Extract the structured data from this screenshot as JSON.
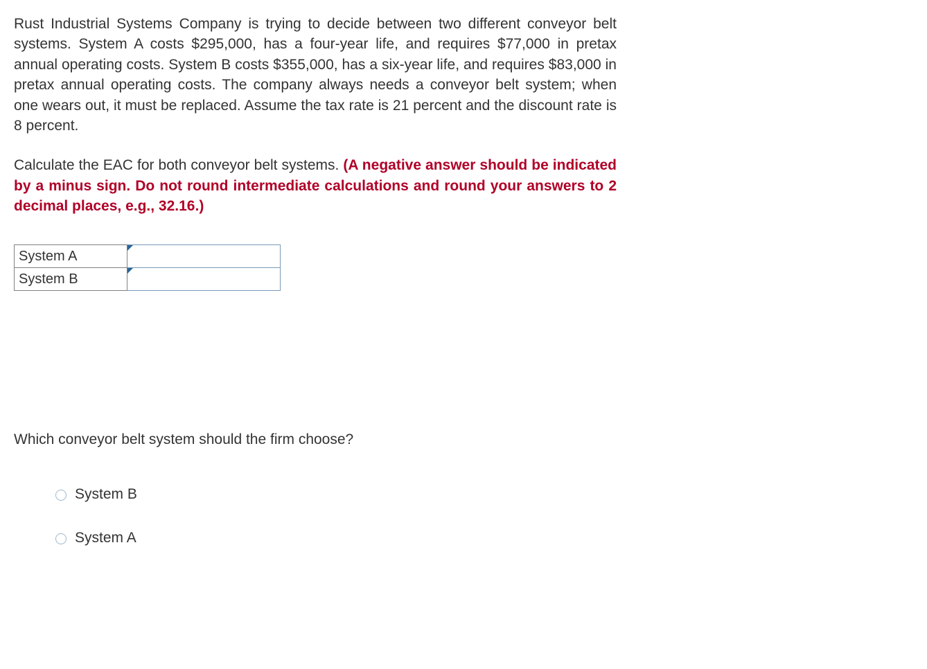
{
  "paragraph": "Rust Industrial Systems Company is trying to decide between two different conveyor belt systems. System A costs $295,000, has a four-year life, and requires $77,000 in pretax annual operating costs. System B costs $355,000, has a six-year life, and requires $83,000 in pretax annual operating costs. The company always needs a conveyor belt system; when one wears out, it must be replaced. Assume the tax rate is 21 percent and the discount rate is 8 percent.",
  "instruction_prefix": "Calculate the EAC for both conveyor belt systems. ",
  "instruction_bold": "(A negative answer should be indicated by a minus sign. Do not round intermediate calculations and round your answers to 2 decimal places, e.g., 32.16.)",
  "table": {
    "rows": [
      {
        "label": "System A",
        "value": ""
      },
      {
        "label": "System B",
        "value": ""
      }
    ]
  },
  "question2": "Which conveyor belt system should the firm choose?",
  "options": [
    {
      "label": "System B"
    },
    {
      "label": "System A"
    }
  ]
}
